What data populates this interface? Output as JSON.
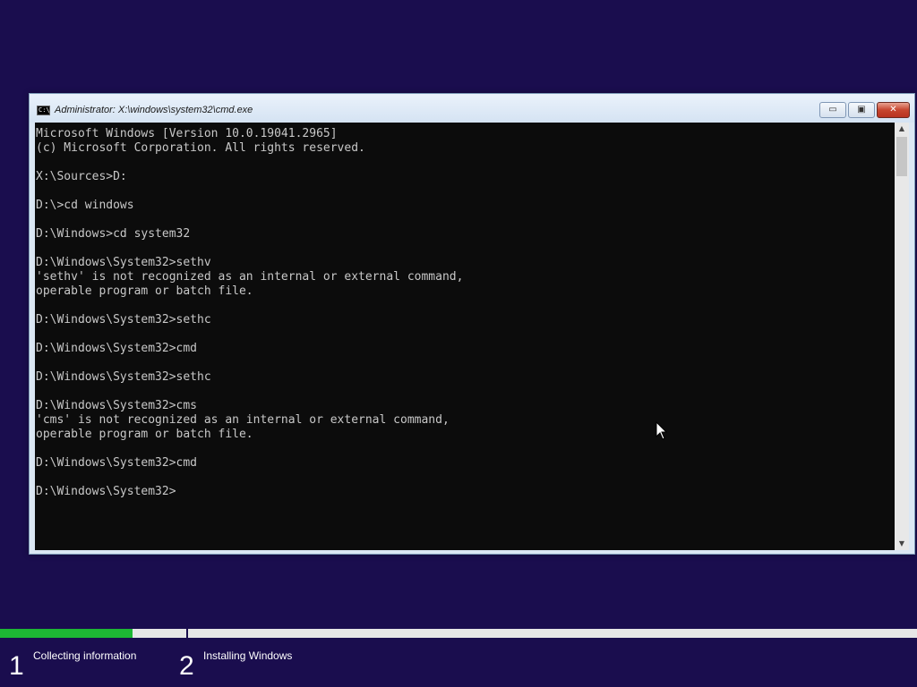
{
  "window": {
    "title": "Administrator: X:\\windows\\system32\\cmd.exe",
    "icon_label": "C:\\",
    "minimize_symbol": "▭",
    "maximize_symbol": "▣",
    "close_symbol": "✕"
  },
  "console": {
    "lines": [
      "Microsoft Windows [Version 10.0.19041.2965]",
      "(c) Microsoft Corporation. All rights reserved.",
      "",
      "X:\\Sources>D:",
      "",
      "D:\\>cd windows",
      "",
      "D:\\Windows>cd system32",
      "",
      "D:\\Windows\\System32>sethv",
      "'sethv' is not recognized as an internal or external command,",
      "operable program or batch file.",
      "",
      "D:\\Windows\\System32>sethc",
      "",
      "D:\\Windows\\System32>cmd",
      "",
      "D:\\Windows\\System32>sethc",
      "",
      "D:\\Windows\\System32>cms",
      "'cms' is not recognized as an internal or external command,",
      "operable program or batch file.",
      "",
      "D:\\Windows\\System32>cmd",
      "",
      "D:\\Windows\\System32>"
    ]
  },
  "scrollbar": {
    "up_symbol": "▲",
    "down_symbol": "▼"
  },
  "setup": {
    "progress_fraction_step1": 0.71,
    "accent_color": "#1db634",
    "background_color": "#1a0d4e",
    "steps": [
      {
        "number": "1",
        "label": "Collecting information"
      },
      {
        "number": "2",
        "label": "Installing Windows"
      }
    ]
  }
}
